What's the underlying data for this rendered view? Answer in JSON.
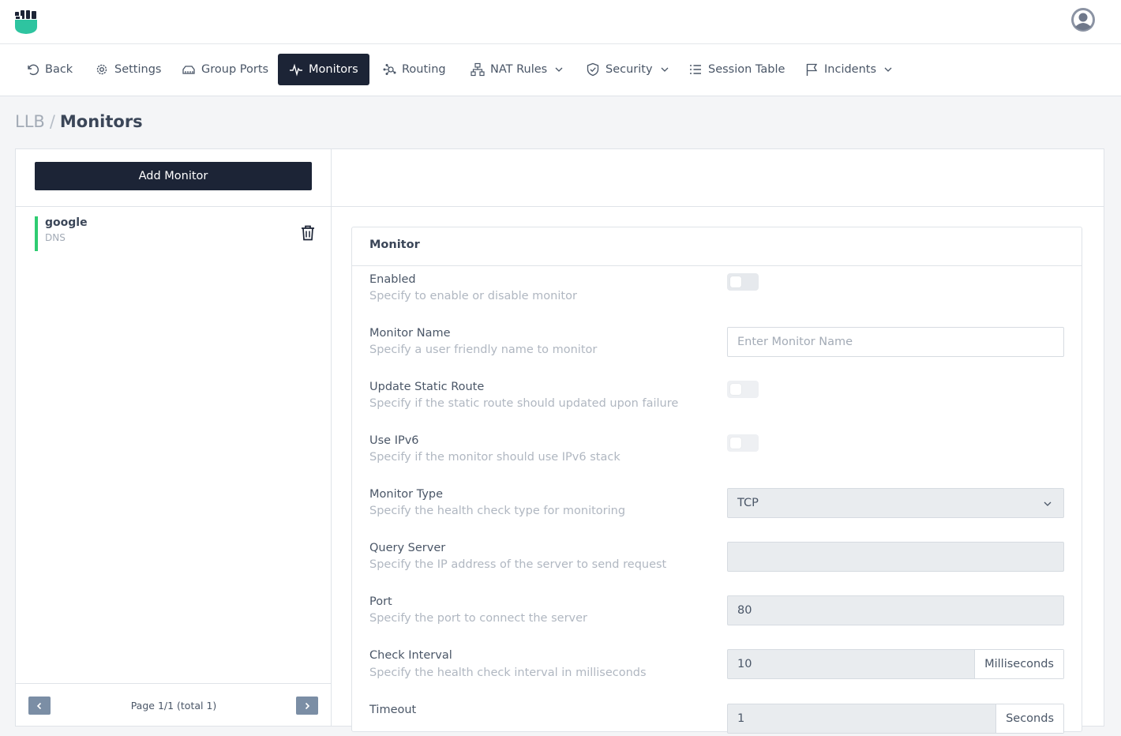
{
  "nav": {
    "items": [
      {
        "label": "Back",
        "icon": "undo-icon"
      },
      {
        "label": "Settings",
        "icon": "gear-icon"
      },
      {
        "label": "Group Ports",
        "icon": "ports-icon"
      },
      {
        "label": "Monitors",
        "icon": "pulse-icon",
        "active": true
      },
      {
        "label": "Routing",
        "icon": "routing-icon"
      },
      {
        "label": "NAT Rules",
        "icon": "network-icon",
        "dropdown": true
      },
      {
        "label": "Security",
        "icon": "shield-icon",
        "dropdown": true
      },
      {
        "label": "Session Table",
        "icon": "list-icon"
      },
      {
        "label": "Incidents",
        "icon": "flag-icon",
        "dropdown": true
      }
    ]
  },
  "breadcrumb": {
    "root": "LLB",
    "separator": "/",
    "current": "Monitors"
  },
  "sidebar": {
    "add_label": "Add Monitor",
    "monitors": [
      {
        "name": "google",
        "type": "DNS",
        "status_color": "#2ecc71"
      }
    ],
    "pager": {
      "text": "Page 1/1 (total 1)"
    }
  },
  "form": {
    "title": "Monitor",
    "enabled": {
      "label": "Enabled",
      "desc": "Specify to enable or disable monitor",
      "value": false
    },
    "name": {
      "label": "Monitor Name",
      "desc": "Specify a user friendly name to monitor",
      "placeholder": "Enter Monitor Name",
      "value": ""
    },
    "static_route": {
      "label": "Update Static Route",
      "desc": "Specify if the static route should updated upon failure",
      "value": false
    },
    "ipv6": {
      "label": "Use IPv6",
      "desc": "Specify if the monitor should use IPv6 stack",
      "value": false
    },
    "type": {
      "label": "Monitor Type",
      "desc": "Specify the health check type for monitoring",
      "value": "TCP"
    },
    "query_server": {
      "label": "Query Server",
      "desc": "Specify the IP address of the server to send request",
      "value": ""
    },
    "port": {
      "label": "Port",
      "desc": "Specify the port to connect the server",
      "value": "80"
    },
    "interval": {
      "label": "Check Interval",
      "desc": "Specify the health check interval in milliseconds",
      "value": "10",
      "unit": "Milliseconds"
    },
    "timeout": {
      "label": "Timeout",
      "value": "1",
      "unit": "Seconds"
    }
  }
}
